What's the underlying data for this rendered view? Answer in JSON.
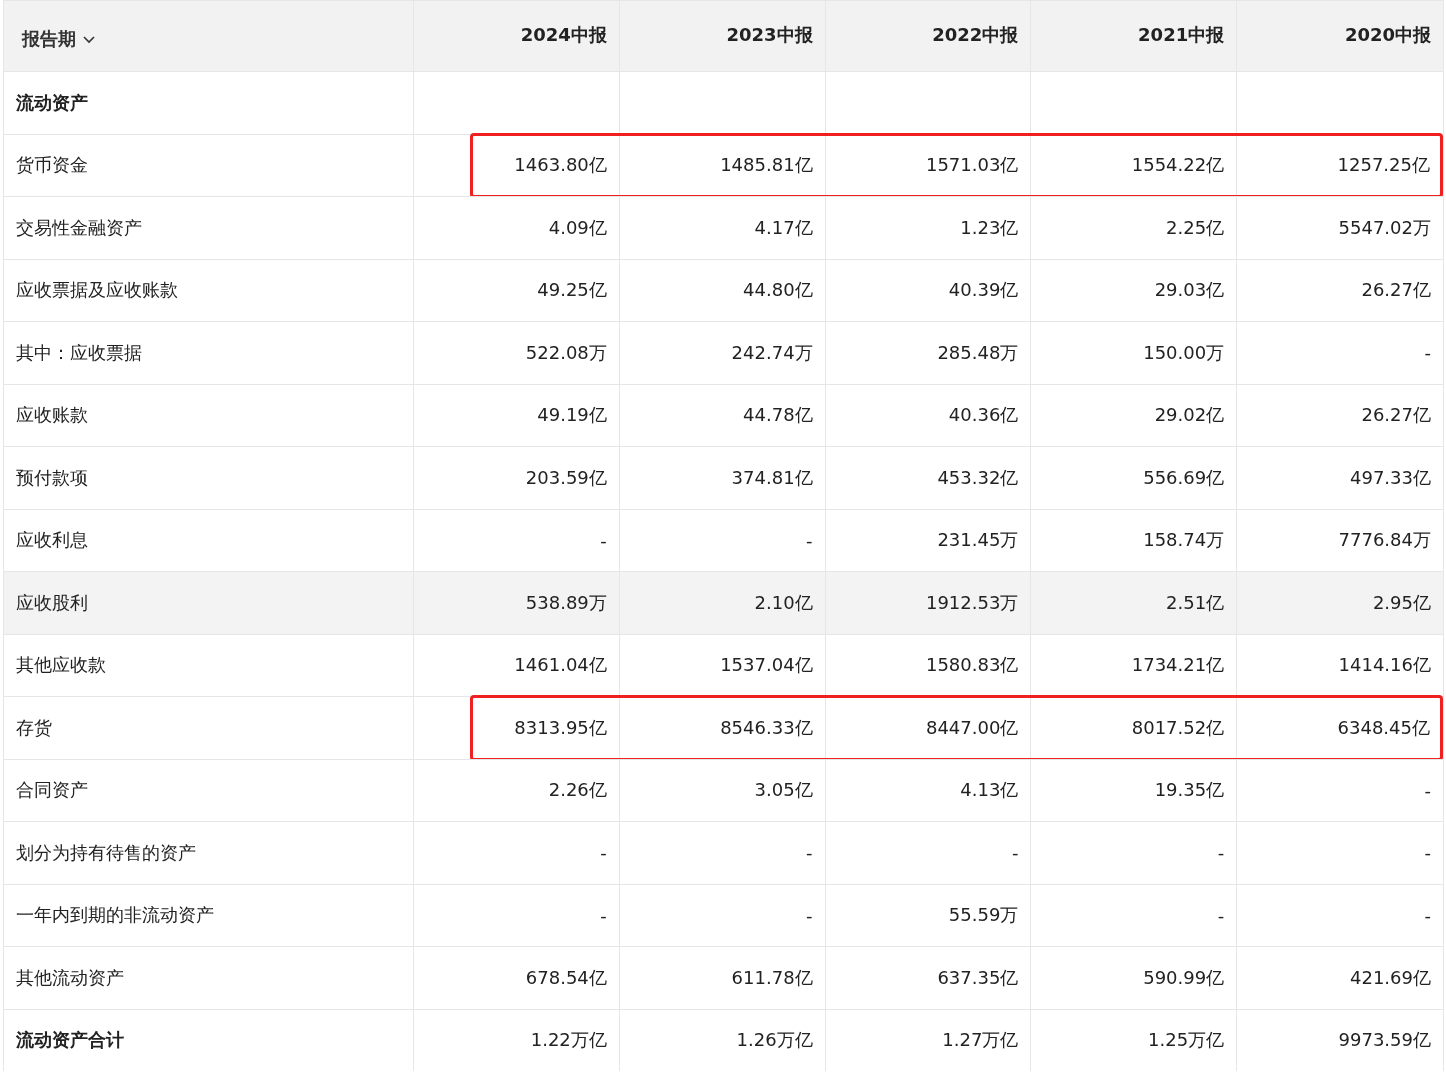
{
  "table": {
    "header": {
      "label": "报告期",
      "columns": [
        "2024中报",
        "2023中报",
        "2022中报",
        "2021中报",
        "2020中报"
      ]
    },
    "rows": [
      {
        "kind": "heading",
        "label": "流动资产",
        "highlighted": false,
        "boxed": false
      },
      {
        "kind": "item",
        "label": "货币资金",
        "values": [
          "1463.80亿",
          "1485.81亿",
          "1571.03亿",
          "1554.22亿",
          "1257.25亿"
        ],
        "highlighted": false,
        "boxed": true
      },
      {
        "kind": "item",
        "label": "交易性金融资产",
        "values": [
          "4.09亿",
          "4.17亿",
          "1.23亿",
          "2.25亿",
          "5547.02万"
        ],
        "highlighted": false,
        "boxed": false
      },
      {
        "kind": "item",
        "label": "应收票据及应收账款",
        "values": [
          "49.25亿",
          "44.80亿",
          "40.39亿",
          "29.03亿",
          "26.27亿"
        ],
        "highlighted": false,
        "boxed": false
      },
      {
        "kind": "item",
        "label": "其中：应收票据",
        "values": [
          "522.08万",
          "242.74万",
          "285.48万",
          "150.00万",
          "-"
        ],
        "highlighted": false,
        "boxed": false
      },
      {
        "kind": "item",
        "label": "应收账款",
        "values": [
          "49.19亿",
          "44.78亿",
          "40.36亿",
          "29.02亿",
          "26.27亿"
        ],
        "highlighted": false,
        "boxed": false
      },
      {
        "kind": "item",
        "label": "预付款项",
        "values": [
          "203.59亿",
          "374.81亿",
          "453.32亿",
          "556.69亿",
          "497.33亿"
        ],
        "highlighted": false,
        "boxed": false
      },
      {
        "kind": "item",
        "label": "应收利息",
        "values": [
          "-",
          "-",
          "231.45万",
          "158.74万",
          "7776.84万"
        ],
        "highlighted": false,
        "boxed": false
      },
      {
        "kind": "item",
        "label": "应收股利",
        "values": [
          "538.89万",
          "2.10亿",
          "1912.53万",
          "2.51亿",
          "2.95亿"
        ],
        "highlighted": true,
        "boxed": false
      },
      {
        "kind": "item",
        "label": "其他应收款",
        "values": [
          "1461.04亿",
          "1537.04亿",
          "1580.83亿",
          "1734.21亿",
          "1414.16亿"
        ],
        "highlighted": false,
        "boxed": false
      },
      {
        "kind": "item",
        "label": "存货",
        "values": [
          "8313.95亿",
          "8546.33亿",
          "8447.00亿",
          "8017.52亿",
          "6348.45亿"
        ],
        "highlighted": false,
        "boxed": true
      },
      {
        "kind": "item",
        "label": "合同资产",
        "values": [
          "2.26亿",
          "3.05亿",
          "4.13亿",
          "19.35亿",
          "-"
        ],
        "highlighted": false,
        "boxed": false
      },
      {
        "kind": "item",
        "label": "划分为持有待售的资产",
        "values": [
          "-",
          "-",
          "-",
          "-",
          "-"
        ],
        "highlighted": false,
        "boxed": false
      },
      {
        "kind": "item",
        "label": "一年内到期的非流动资产",
        "values": [
          "-",
          "-",
          "55.59万",
          "-",
          "-"
        ],
        "highlighted": false,
        "boxed": false
      },
      {
        "kind": "item",
        "label": "其他流动资产",
        "values": [
          "678.54亿",
          "611.78亿",
          "637.35亿",
          "590.99亿",
          "421.69亿"
        ],
        "highlighted": false,
        "boxed": false
      },
      {
        "kind": "total",
        "label": "流动资产合计",
        "values": [
          "1.22万亿",
          "1.26万亿",
          "1.27万亿",
          "1.25万亿",
          "9973.59亿"
        ],
        "highlighted": false,
        "boxed": false
      }
    ]
  }
}
